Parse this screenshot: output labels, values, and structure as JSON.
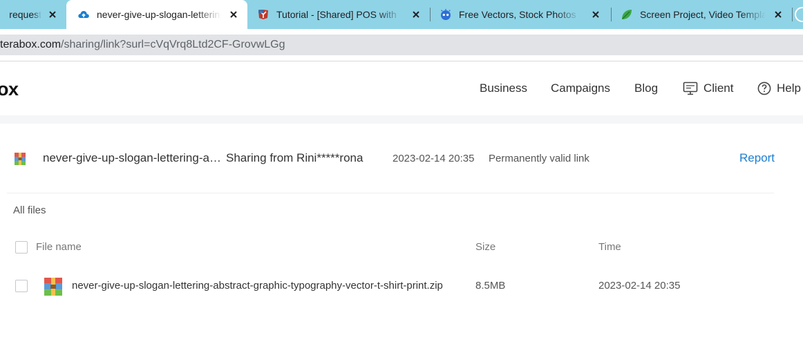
{
  "browser": {
    "tabs": [
      {
        "title": "request",
        "icon": "page-icon"
      },
      {
        "title": "never-give-up-slogan-lettering",
        "icon": "cloud-upload-icon"
      },
      {
        "title": "Tutorial - [Shared] POS with",
        "icon": "vscode-like-icon"
      },
      {
        "title": "Free Vectors, Stock Photos &",
        "icon": "robot-face-icon"
      },
      {
        "title": "Screen Project, Video Template",
        "icon": "leaf-icon"
      }
    ],
    "url_host": "terabox.com",
    "url_path": "/sharing/link?surl=cVqVrq8Ltd2CF-GrovwLGg"
  },
  "site": {
    "logo": "ox",
    "nav": {
      "business": "Business",
      "campaigns": "Campaigns",
      "blog": "Blog",
      "client": "Client",
      "help": "Help"
    }
  },
  "share": {
    "filename": "never-give-up-slogan-lettering-abstract-graphic-typography-vector-t-shirt-print.zip",
    "from": "Sharing from Rini*****rona",
    "date": "2023-02-14 20:35",
    "validity": "Permanently valid link",
    "report": "Report"
  },
  "files": {
    "section_label": "All files",
    "columns": {
      "name": "File name",
      "size": "Size",
      "time": "Time"
    },
    "rows": [
      {
        "name": "never-give-up-slogan-lettering-abstract-graphic-typography-vector-t-shirt-print.zip",
        "size": "8.5MB",
        "time": "2023-02-14 20:35"
      }
    ]
  },
  "colors": {
    "tabstrip": "#8fd3e6",
    "link": "#1b7fd1",
    "url_field": "#e1e3e6"
  }
}
